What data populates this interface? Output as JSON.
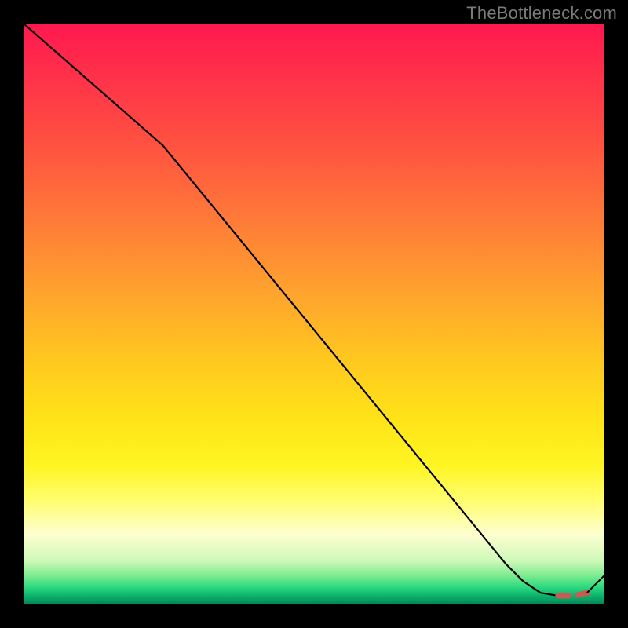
{
  "watermark": "TheBottleneck.com",
  "chart_data": {
    "type": "line",
    "title": "",
    "xlabel": "",
    "ylabel": "",
    "xlim": [
      0,
      100
    ],
    "ylim": [
      0,
      100
    ],
    "grid": false,
    "series": [
      {
        "name": "bottleneck-curve",
        "style": "solid-then-dashed",
        "color": "#000000",
        "dash_color": "#c95a54",
        "x": [
          0,
          24,
          83,
          86,
          89,
          92,
          95,
          97,
          100
        ],
        "y": [
          100,
          79,
          7,
          4,
          2,
          1.5,
          1.5,
          2,
          5
        ],
        "dashed_from_index": 5
      }
    ],
    "marker": {
      "x": 97,
      "y": 2,
      "color": "#c95a54",
      "r": 4
    },
    "background_gradient": {
      "top": "#ff1850",
      "mid": "#ffe318",
      "bottom": "#058354"
    }
  }
}
